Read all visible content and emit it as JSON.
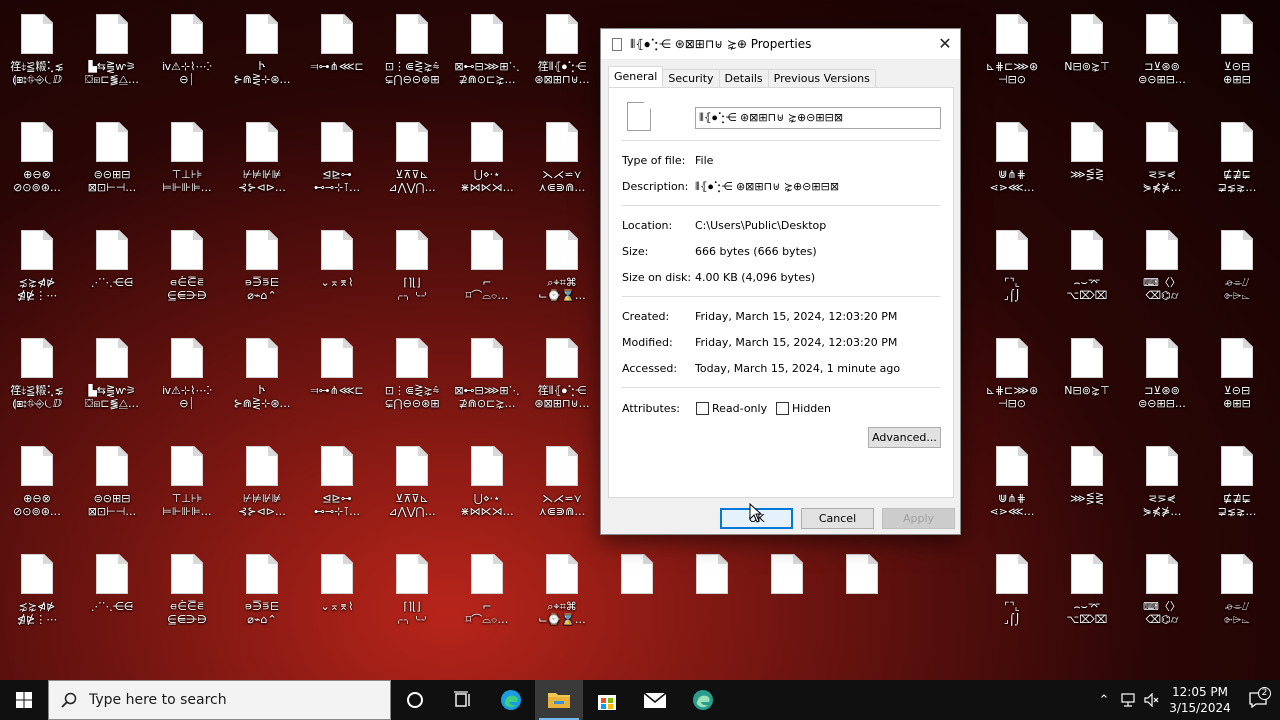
{
  "desktop": {
    "icons": [
      [
        "䇮⤈⪟䊛⢅⋦",
        "⟬⧆⦂⛗⎆⏾ⅅ"
      ],
      [
        "▙⇆⪌ⱳ⚞",
        "⛋⧆⊏⪓⧋…"
      ],
      [
        "ⅳ⚠⊹⌇⋯ⴾ",
        "⊖⏐"
      ],
      [
        "Ⴡ",
        "⊱⋒⋛⊹⊛…"
      ],
      [
        "⫤⊶⋔⋘⊏",
        ""
      ],
      [
        "⊡⋮⋐⋛⋩⩯",
        "⊊⋂⊖⊝⊛⊞"
      ],
      [
        "⊠⊷⊟⋙⊞⋱",
        "⊉⋒⊙⊏⋩…"
      ],
      [
        "䇮⦀⦃⦁⢑⋲",
        "⊛⊠⊞⊓⊎…"
      ],
      [
        "",
        ""
      ],
      [
        "",
        ""
      ],
      [
        "",
        ""
      ],
      [
        "",
        ""
      ],
      [
        "⊾⋕⊏⋙⊛",
        "⊣⊟⊙"
      ],
      [
        "N⊟⊚⋩⊤",
        ""
      ],
      [
        "⊐⊻⊛⊚",
        "⊜⊝⊞⊟…"
      ],
      [
        "⊻⊝⊟",
        "⊕⊞⊟"
      ],
      [
        "⊕⊖⊗",
        "⊘⊙⊚⊛…"
      ],
      [
        "⊜⊝⊞⊟",
        "⊠⊡⊢⊣…"
      ],
      [
        "⊤⊥⊦⊧",
        "⊨⊩⊪⊫…"
      ],
      [
        "⊬⊭⊮⊯",
        "⊰⊱⊲⊳…"
      ],
      [
        "⊴⊵⊶",
        "⊷⊸⊹⊺…"
      ],
      [
        "⊻⊼⊽⊾",
        "⊿⋀⋁⋂…"
      ],
      [
        "⋃⋄⋅⋆",
        "⋇⋈⋉⋊…"
      ],
      [
        "⋋⋌⋍⋎",
        "⋏⋐⋑⋒…"
      ],
      [
        "",
        ""
      ],
      [
        "",
        ""
      ],
      [
        "",
        ""
      ],
      [
        "",
        ""
      ],
      [
        "⋓⋔⋕",
        "⋖⋗⋘…"
      ],
      [
        "⋙⋚⋛",
        ""
      ],
      [
        "⋜⋝⋞",
        "⋟⋠⋡…"
      ],
      [
        "⋢⋣⋤",
        "⋥⋦⋧…"
      ],
      [
        "⋨⋩⋪⋫",
        "⋬⋭⋮⋯"
      ],
      [
        "⋰⋱⋲⋳",
        ""
      ],
      [
        "⋴⋵⋶⋷",
        "⋸⋹⋺⋻"
      ],
      [
        "⋼⋽⋾⋿",
        "⌀⌁⌂⌃"
      ],
      [
        "⌄⌅⌆⌇",
        ""
      ],
      [
        "⌈⌉⌊⌋",
        "⌌⌍⌎⌏"
      ],
      [
        "⌐",
        "⌑⌒⌓⌔…"
      ],
      [
        "⌕⌖⌗⌘",
        "⌙⌚⌛…"
      ],
      [
        "",
        ""
      ],
      [
        "",
        ""
      ],
      [
        "",
        ""
      ],
      [
        "",
        ""
      ],
      [
        "⌜⌝⌞",
        "⌟⌠⌡"
      ],
      [
        "⌢⌣⌤",
        "⌥⌦⌧"
      ],
      [
        "⌨〈〉",
        "⌫⌬⌭"
      ],
      [
        "⌮⌯⌰",
        "⌱⌲⌳"
      ]
    ]
  },
  "dialog": {
    "title": "⦀⦃⦁⢑⋲ ⊛⊠⊞⊓⊎ ⋩⊕ Properties",
    "close_glyph": "✕",
    "tabs": [
      "General",
      "Security",
      "Details",
      "Previous Versions"
    ],
    "file_name": "⦀⦃⦁⢑⋲ ⊛⊠⊞⊓⊎ ⋩⊕⊝⊞⊟⊠",
    "type_label": "Type of file:",
    "type_value": "File",
    "description_label": "Description:",
    "description_value": "⦀⦃⦁⢑⋲ ⊛⊠⊞⊓⊎ ⋩⊕⊝⊞⊟⊠",
    "location_label": "Location:",
    "location_value": "C:\\Users\\Public\\Desktop",
    "size_label": "Size:",
    "size_value": "666 bytes (666 bytes)",
    "size_on_disk_label": "Size on disk:",
    "size_on_disk_value": "4.00 KB (4,096 bytes)",
    "created_label": "Created:",
    "created_value": "Friday, March 15, 2024, 12:03:20 PM",
    "modified_label": "Modified:",
    "modified_value": "Friday, March 15, 2024, 12:03:20 PM",
    "accessed_label": "Accessed:",
    "accessed_value": "Today, March 15, 2024, 1 minute ago",
    "attributes_label": "Attributes:",
    "readonly_label": "Read-only",
    "hidden_label": "Hidden",
    "advanced_label": "Advanced...",
    "ok_label": "OK",
    "cancel_label": "Cancel",
    "apply_label": "Apply"
  },
  "taskbar": {
    "search_placeholder": "Type here to search",
    "time": "12:05 PM",
    "date": "3/15/2024",
    "notification_count": "2",
    "accent": "#76b9ed"
  }
}
